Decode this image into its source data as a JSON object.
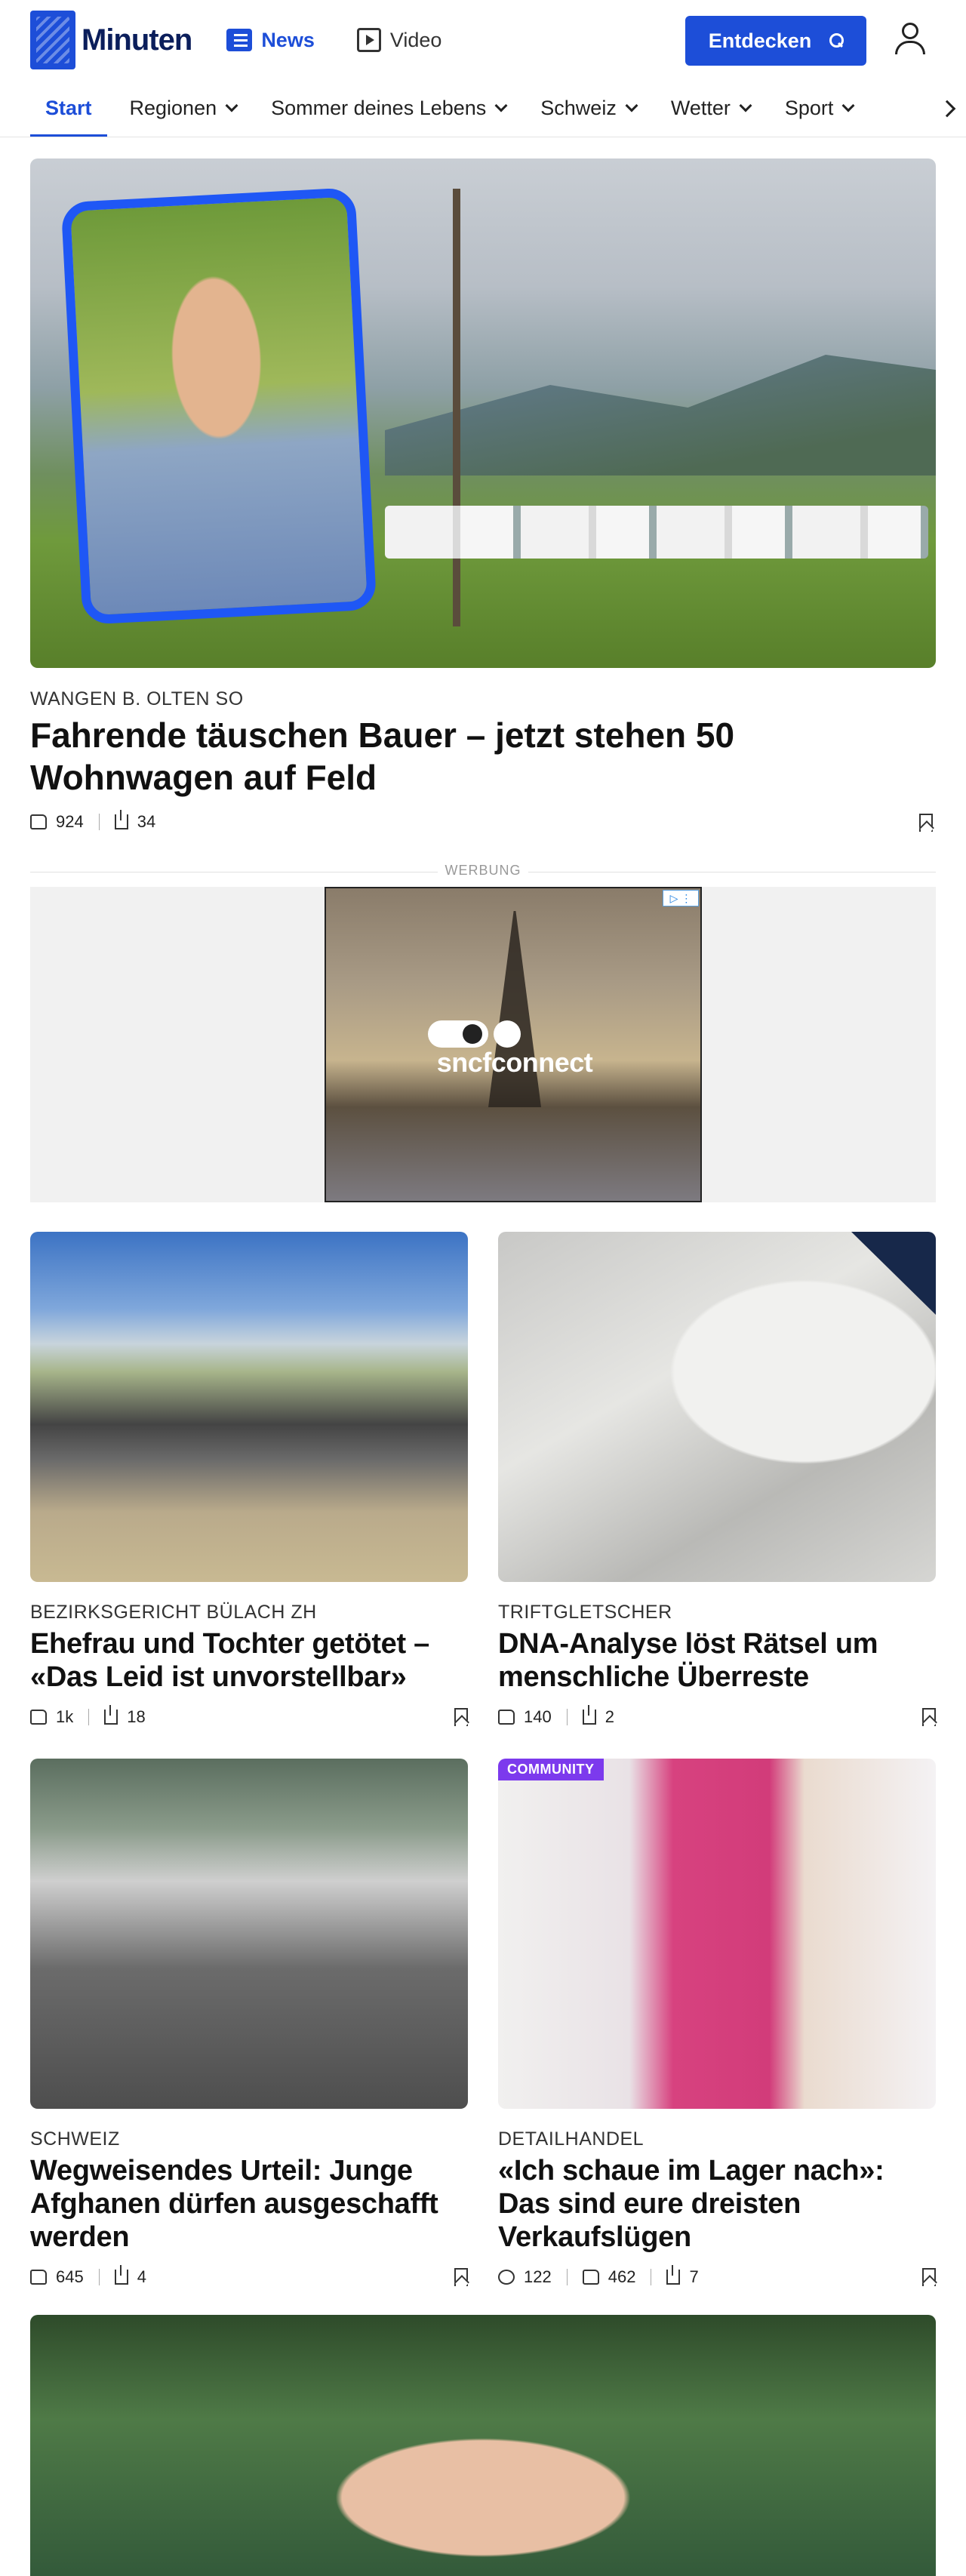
{
  "header": {
    "logo_text": "Minuten",
    "tabs": [
      {
        "label": "News",
        "icon": "news-icon",
        "active": true
      },
      {
        "label": "Video",
        "icon": "video-icon",
        "active": false
      }
    ],
    "discover_label": "Entdecken",
    "accent_color": "#1d4ed8"
  },
  "subnav": {
    "items": [
      {
        "label": "Start",
        "active": true,
        "dropdown": false
      },
      {
        "label": "Regionen",
        "active": false,
        "dropdown": true
      },
      {
        "label": "Sommer deines Lebens",
        "active": false,
        "dropdown": true
      },
      {
        "label": "Schweiz",
        "active": false,
        "dropdown": true
      },
      {
        "label": "Wetter",
        "active": false,
        "dropdown": true
      },
      {
        "label": "Sport",
        "active": false,
        "dropdown": true
      }
    ]
  },
  "hero": {
    "kicker": "WANGEN B. OLTEN SO",
    "title": "Fahrende täuschen Bauer – jetzt stehen 50 Wohnwagen auf Feld",
    "likes": "924",
    "shares": "34"
  },
  "ad": {
    "label": "WERBUNG",
    "brand": "sncfconnect"
  },
  "cards": [
    {
      "kicker": "BEZIRKSGERICHT BÜLACH ZH",
      "title": "Ehefrau und Tochter getötet – «Das Leid ist unvorstellbar»",
      "likes": "1k",
      "shares": "18"
    },
    {
      "kicker": "TRIFTGLETSCHER",
      "title": "DNA-Analyse löst Rätsel um menschliche Überreste",
      "likes": "140",
      "shares": "2"
    },
    {
      "kicker": "SCHWEIZ",
      "title": "Wegweisendes Urteil: Junge Afghanen dürfen ausgeschafft werden",
      "likes": "645",
      "shares": "4"
    },
    {
      "badge": "COMMUNITY",
      "kicker": "DETAILHANDEL",
      "title": "«Ich schaue im Lager nach»: Das sind eure dreisten Verkaufslügen",
      "comments": "122",
      "likes": "462",
      "shares": "7",
      "badge_color": "#7c3aed"
    }
  ]
}
